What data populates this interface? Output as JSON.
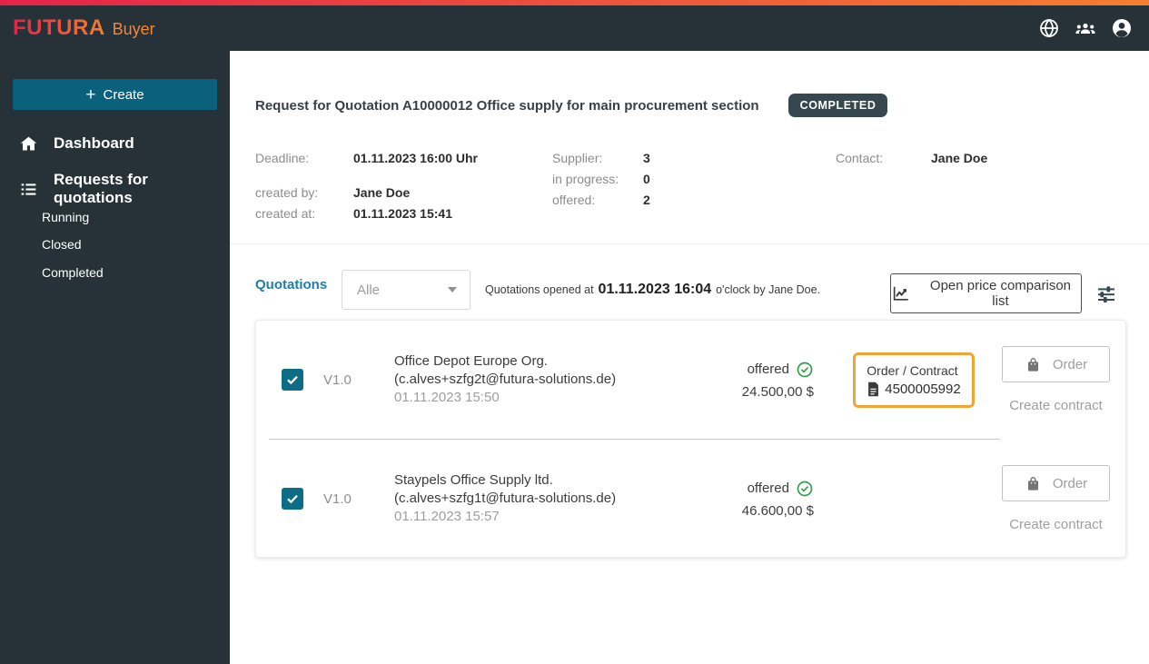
{
  "header": {
    "brand": "FUTURA",
    "brand_suffix": "Buyer",
    "icons": [
      "globe-icon",
      "groups-icon",
      "account-icon"
    ]
  },
  "sidebar": {
    "create_label": "Create",
    "dashboard": "Dashboard",
    "requests": "Requests for quotations",
    "running": "Running",
    "closed": "Closed",
    "completed": "Completed"
  },
  "request": {
    "title": "Request for Quotation A10000012 Office supply for main procurement section",
    "status": "COMPLETED",
    "details": {
      "deadline_label": "Deadline:",
      "deadline": "01.11.2023 16:00 Uhr",
      "created_by_label": "created by:",
      "created_by": "Jane Doe",
      "created_at_label": "created at:",
      "created_at": "01.11.2023 15:41",
      "supplier_label": "Supplier:",
      "supplier_count": "3",
      "in_progress_label": "in progress:",
      "in_progress_count": "0",
      "offered_label": "offered:",
      "offered_count": "2",
      "contact_label": "Contact:",
      "contact": "Jane Doe"
    }
  },
  "quotations": {
    "section_label": "Quotations",
    "filter_value": "Alle",
    "opened_prefix": "Quotations opened at",
    "opened_datetime": "01.11.2023 16:04",
    "opened_suffix": "o'clock by Jane Doe.",
    "compare_button": "Open price comparison list",
    "rows": [
      {
        "version": "V1.0",
        "supplier": "Office Depot Europe Org.",
        "email": "(c.alves+szfg2t@futura-solutions.de)",
        "date": "01.11.2023 15:50",
        "status": "offered",
        "amount": "24.500,00 $",
        "order_contract_label": "Order / Contract",
        "order_number": "4500005992",
        "order_button": "Order",
        "create_contract": "Create contract"
      },
      {
        "version": "V1.0",
        "supplier": "Staypels Office Supply ltd.",
        "email": "(c.alves+szfg1t@futura-solutions.de)",
        "date": "01.11.2023 15:57",
        "status": "offered",
        "amount": "46.600,00 $",
        "order_button": "Order",
        "create_contract": "Create contract"
      }
    ]
  },
  "colors": {
    "navy": "#263238",
    "teal": "#0b617c",
    "teal_checkbox": "#0d6c86",
    "brand_orange": "#f58634",
    "gradient_start": "#e62249",
    "gradient_end": "#f57f2f",
    "accent_link": "#1d7fa5",
    "status_green": "#2e9e4b",
    "highlight_orange": "#f0a434",
    "badge_bg": "#37474f"
  }
}
